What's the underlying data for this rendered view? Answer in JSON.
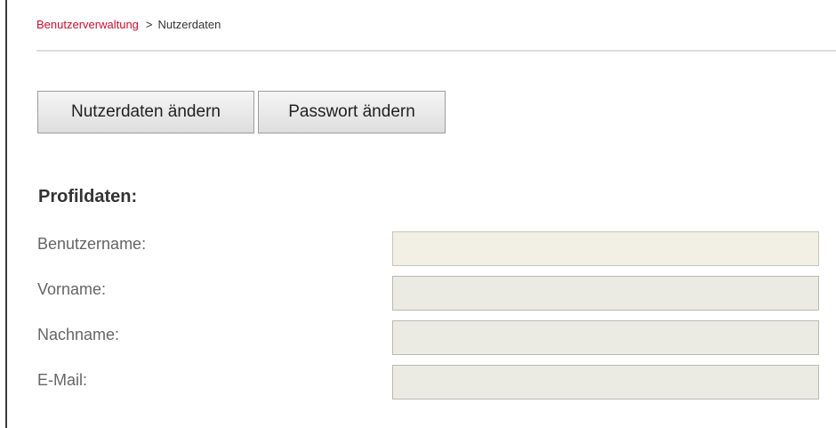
{
  "breadcrumb": {
    "parent": "Benutzerverwaltung",
    "separator": ">",
    "current": "Nutzerdaten"
  },
  "actions": {
    "edit_userdata_label": "Nutzerdaten ändern",
    "change_password_label": "Passwort ändern"
  },
  "profile": {
    "title": "Profildaten:",
    "fields": [
      {
        "label": "Benutzername:",
        "value": ""
      },
      {
        "label": "Vorname:",
        "value": ""
      },
      {
        "label": "Nachname:",
        "value": ""
      },
      {
        "label": "E-Mail:",
        "value": ""
      }
    ]
  },
  "colors": {
    "link": "#c8102e",
    "input_background": "#ebebe4"
  }
}
